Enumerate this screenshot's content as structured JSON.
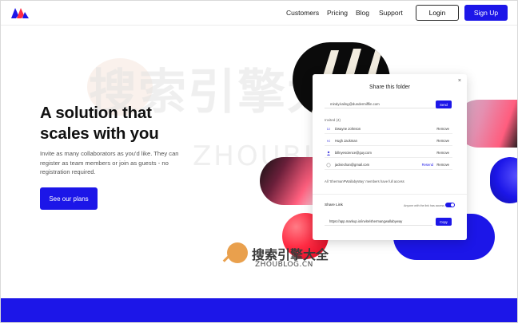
{
  "header": {
    "nav": [
      "Customers",
      "Pricing",
      "Blog",
      "Support"
    ],
    "login_label": "Login",
    "signup_label": "Sign Up"
  },
  "hero": {
    "title_line1": "A solution that",
    "title_line2": "scales with you",
    "description": "Invite as many collaborators as you'd like. They can register as team members or join as guests - no registration required.",
    "cta_label": "See our plans"
  },
  "dialog": {
    "title": "Share this folder",
    "close": "×",
    "email_value": "mindy.kaling@dundermifflin.com",
    "send_label": "Send",
    "invited_label": "Invited (4)",
    "invited": [
      {
        "initials": "DJ",
        "name": "Dwayne Johnson",
        "action": "Remove"
      },
      {
        "initials": "HJ",
        "name": "Hugh Jackman",
        "action": "Remove"
      },
      {
        "initials": "",
        "name": "billnyescience@guy.com",
        "action": "Remove"
      },
      {
        "initials": "",
        "name": "jackiechan@gmail.com",
        "resend": "Resend",
        "action": "Remove"
      }
    ],
    "access_note": "All 'ShermanPWallabyWay' members have full access",
    "share_link_label": "Share Link",
    "share_link_hint": "Anyone with the link has access",
    "link_value": "https://app.markup.io/invite/shermangwallabyway",
    "copy_label": "Copy"
  },
  "watermark": {
    "cn": "搜索引擎大全",
    "en": "ZHOUBLOG.CN"
  },
  "colors": {
    "accent": "#1c16e8",
    "pink": "#ff5d7e",
    "red": "#ff2b43"
  }
}
